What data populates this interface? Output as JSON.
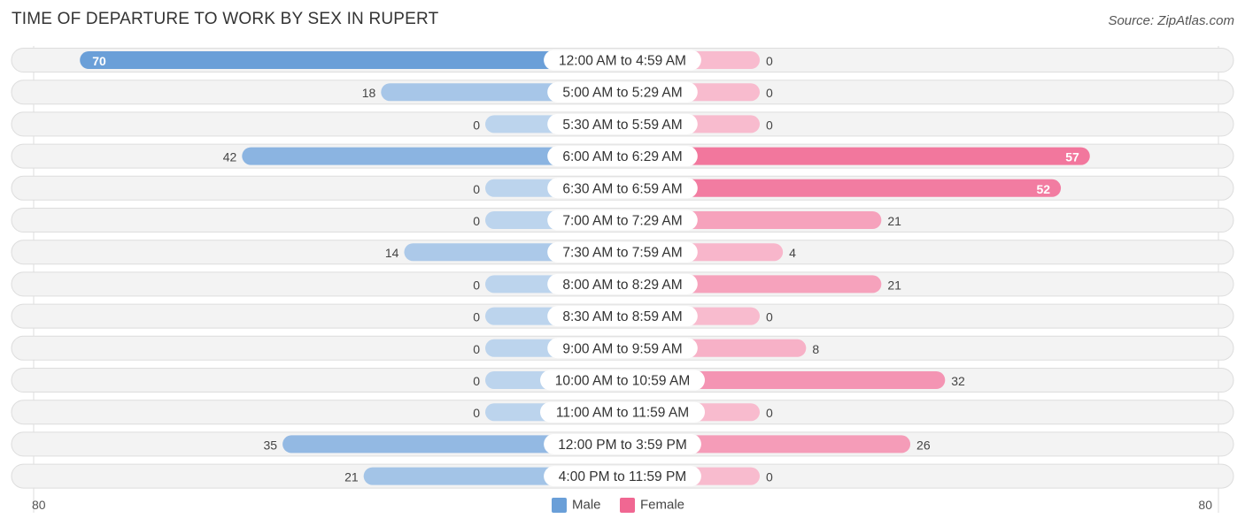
{
  "title": "TIME OF DEPARTURE TO WORK BY SEX IN RUPERT",
  "source": "Source: ZipAtlas.com",
  "chart_data": {
    "type": "bar",
    "orientation": "horizontal-diverging",
    "title": "TIME OF DEPARTURE TO WORK BY SEX IN RUPERT",
    "categories": [
      "12:00 AM to 4:59 AM",
      "5:00 AM to 5:29 AM",
      "5:30 AM to 5:59 AM",
      "6:00 AM to 6:29 AM",
      "6:30 AM to 6:59 AM",
      "7:00 AM to 7:29 AM",
      "7:30 AM to 7:59 AM",
      "8:00 AM to 8:29 AM",
      "8:30 AM to 8:59 AM",
      "9:00 AM to 9:59 AM",
      "10:00 AM to 10:59 AM",
      "11:00 AM to 11:59 AM",
      "12:00 PM to 3:59 PM",
      "4:00 PM to 11:59 PM"
    ],
    "series": [
      {
        "name": "Male",
        "color": "#6a9fd8",
        "values": [
          70,
          18,
          0,
          42,
          0,
          0,
          14,
          0,
          0,
          0,
          0,
          0,
          35,
          21
        ]
      },
      {
        "name": "Female",
        "color": "#f06792",
        "values": [
          0,
          0,
          0,
          57,
          52,
          21,
          4,
          21,
          0,
          8,
          32,
          0,
          26,
          0
        ]
      }
    ],
    "axis": {
      "left_label": "80",
      "right_label": "80",
      "max": 80
    },
    "legend": {
      "position": "bottom-center",
      "items": [
        "Male",
        "Female"
      ]
    }
  }
}
